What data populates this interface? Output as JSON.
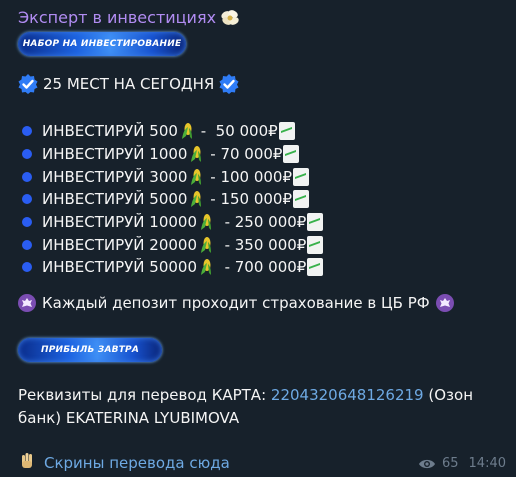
{
  "channel": {
    "title": "Эксперт в инвестициях"
  },
  "banners": {
    "top": "НАБОР НА ИНВЕСТИРОВАНИЕ",
    "profit": "ПРИБЫЛЬ ЗАВТРА"
  },
  "headline": "25 МЕСТ НА СЕГОДНЯ",
  "investments": [
    {
      "label": "ИНВЕСТИРУЙ 500",
      "sep": " -  ",
      "payout": "50 000₽"
    },
    {
      "label": "ИНВЕСТИРУЙ 1000",
      "sep": " - ",
      "payout": "70 000₽"
    },
    {
      "label": "ИНВЕСТИРУЙ 3000",
      "sep": " - ",
      "payout": "100 000₽"
    },
    {
      "label": "ИНВЕСТИРУЙ 5000",
      "sep": " - ",
      "payout": "150 000₽"
    },
    {
      "label": "ИНВЕСТИРУЙ 10000",
      "sep": "  - ",
      "payout": "250 000₽"
    },
    {
      "label": "ИНВЕСТИРУЙ 20000",
      "sep": "  - ",
      "payout": "350 000₽"
    },
    {
      "label": "ИНВЕСТИРУЙ 50000",
      "sep": "  - ",
      "payout": "700 000₽"
    }
  ],
  "insurance": "Каждый депозит проходит страхование в ЦБ РФ",
  "requisites": {
    "label": "Реквизиты для перевод КАРТА:",
    "card_number": "2204320648126219",
    "rest": "(Озон банк) EKATERINA LYUBIMOVA"
  },
  "screens_link": "Скрины перевода сюда",
  "meta": {
    "views": "65",
    "time": "14:40"
  },
  "icons": {
    "check": "verified-check-icon",
    "corn": "corn-icon",
    "chart": "chart-up-icon",
    "emblem": "cb-emblem-icon",
    "flower": "flower-icon",
    "eye": "eye-icon"
  },
  "colors": {
    "background": "#17212b",
    "title": "#b18cf2",
    "link": "#6ea9e3",
    "bullet": "#2a5df2"
  }
}
